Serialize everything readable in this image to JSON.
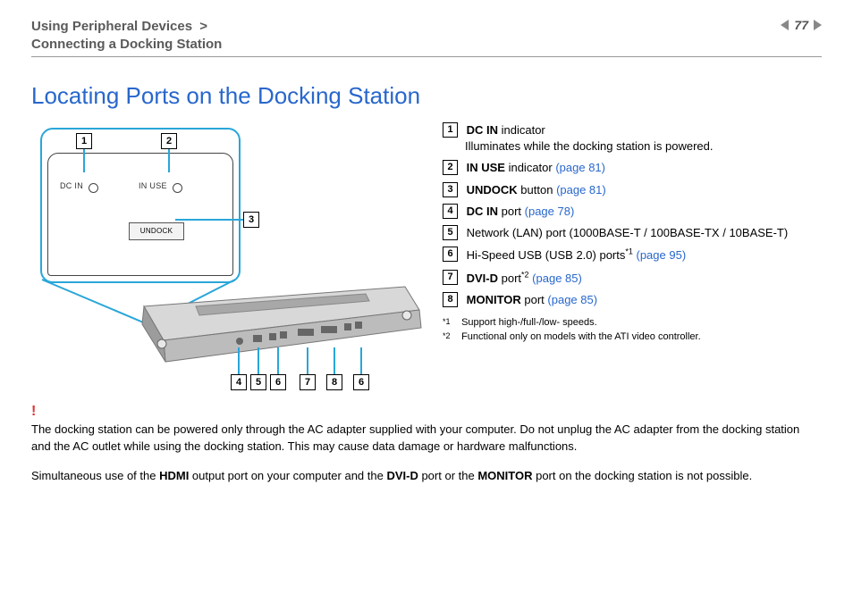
{
  "header": {
    "breadcrumb_line1": "Using Peripheral Devices",
    "breadcrumb_sep": ">",
    "breadcrumb_line2": "Connecting a Docking Station",
    "page_number": "77"
  },
  "title": "Locating Ports on the Docking Station",
  "figure": {
    "panel_labels": {
      "dc_in": "DC IN",
      "in_use": "IN USE",
      "undock": "UNDOCK"
    },
    "callouts_top": {
      "n1": "1",
      "n2": "2",
      "n3": "3"
    },
    "callouts_bottom": {
      "n4": "4",
      "n5": "5",
      "n6": "6",
      "n7": "7",
      "n8": "8",
      "n6b": "6"
    }
  },
  "legend": [
    {
      "num": "1",
      "bold": "DC IN",
      "rest": " indicator",
      "sub": "Illuminates while the docking station is powered."
    },
    {
      "num": "2",
      "bold": "IN USE",
      "rest": " indicator ",
      "link": "(page 81)"
    },
    {
      "num": "3",
      "bold": "UNDOCK",
      "rest": " button ",
      "link": "(page 81)"
    },
    {
      "num": "4",
      "bold": "DC IN",
      "rest": " port ",
      "link": "(page 78)"
    },
    {
      "num": "5",
      "plain": "Network (LAN) port (1000BASE-T / 100BASE-TX / 10BASE-T)"
    },
    {
      "num": "6",
      "plain_pre": "Hi-Speed USB (USB 2.0) ports",
      "sup": "*1",
      "rest": " ",
      "link": "(page 95)"
    },
    {
      "num": "7",
      "bold": "DVI-D",
      "rest": " port",
      "sup": "*2",
      "rest2": " ",
      "link": "(page 85)"
    },
    {
      "num": "8",
      "bold": "MONITOR",
      "rest": " port ",
      "link": "(page 85)"
    }
  ],
  "footnotes": [
    {
      "mark": "*1",
      "text": "Support high-/full-/low- speeds."
    },
    {
      "mark": "*2",
      "text": "Functional only on models with the ATI video controller."
    }
  ],
  "warning": {
    "mark": "!",
    "text": "The docking station can be powered only through the AC adapter supplied with your computer. Do not unplug the AC adapter from the docking station and the AC outlet while using the docking station. This may cause data damage or hardware malfunctions."
  },
  "note2": {
    "pre": "Simultaneous use of the ",
    "b1": "HDMI",
    "mid1": " output port on your computer and the ",
    "b2": "DVI-D",
    "mid2": " port or the ",
    "b3": "MONITOR",
    "post": " port on the docking station is not possible."
  }
}
